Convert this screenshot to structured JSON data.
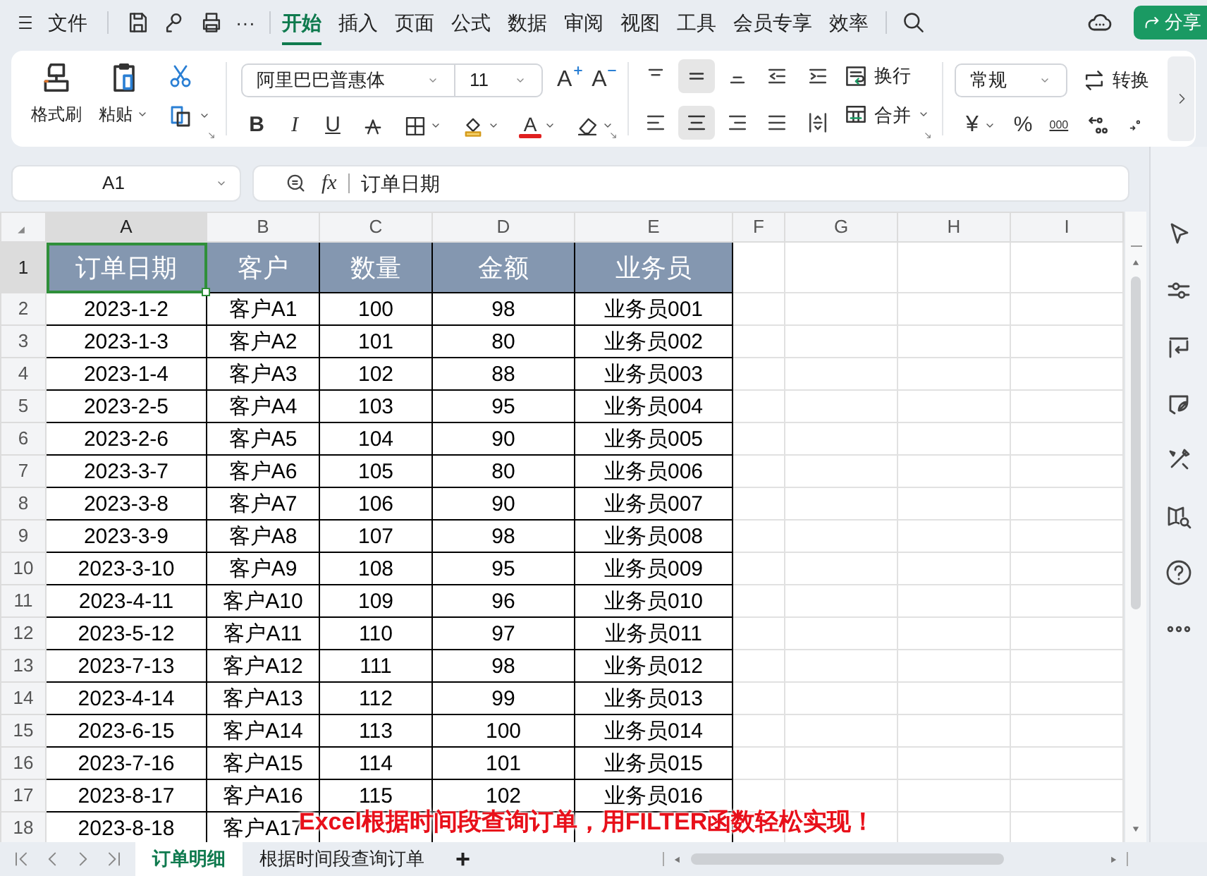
{
  "top_bar": {
    "file_menu": "文件",
    "more": "···",
    "tabs": [
      {
        "label": "开始",
        "selected": true
      },
      {
        "label": "插入",
        "selected": false
      },
      {
        "label": "页面",
        "selected": false
      },
      {
        "label": "公式",
        "selected": false
      },
      {
        "label": "数据",
        "selected": false
      },
      {
        "label": "审阅",
        "selected": false
      },
      {
        "label": "视图",
        "selected": false
      },
      {
        "label": "工具",
        "selected": false
      },
      {
        "label": "会员专享",
        "selected": false
      },
      {
        "label": "效率",
        "selected": false
      }
    ],
    "share_button": "分享"
  },
  "ribbon": {
    "format_painter": "格式刷",
    "paste": "粘贴",
    "font_name": "阿里巴巴普惠体",
    "font_size": "11",
    "grow_font": "A",
    "shrink_font": "A",
    "styles": [
      {
        "kind": "bold",
        "label": "B"
      },
      {
        "kind": "italic",
        "label": "I"
      },
      {
        "kind": "underline",
        "label": "U"
      }
    ],
    "font_color": "A",
    "align_buttons": [
      {
        "kind": "top",
        "selected": false
      },
      {
        "kind": "middle",
        "selected": true
      },
      {
        "kind": "bottom",
        "selected": false
      },
      {
        "kind": "outdent",
        "selected": false
      },
      {
        "kind": "indent",
        "selected": false
      },
      {
        "kind": "left",
        "selected": false
      },
      {
        "kind": "center",
        "selected": true
      },
      {
        "kind": "right",
        "selected": false
      },
      {
        "kind": "justify",
        "selected": false
      },
      {
        "kind": "distributed",
        "selected": false
      }
    ],
    "wrap": "换行",
    "merge": "合并",
    "number_format": "常规",
    "convert": "转换",
    "currency": "¥",
    "percent": "%",
    "thousands": "000"
  },
  "formula_bar": {
    "name_box": "A1",
    "fx": "fx",
    "value": "订单日期"
  },
  "sheet": {
    "columns": [
      {
        "label": "A",
        "selected": true
      },
      {
        "label": "B",
        "selected": false
      },
      {
        "label": "C",
        "selected": false
      },
      {
        "label": "D",
        "selected": false
      },
      {
        "label": "E",
        "selected": false
      },
      {
        "label": "F",
        "selected": false
      },
      {
        "label": "G",
        "selected": false
      },
      {
        "label": "H",
        "selected": false
      },
      {
        "label": "I",
        "selected": false
      }
    ],
    "rows": [
      {
        "number": "1",
        "selected": true,
        "kind": "header",
        "cells": [
          "订单日期",
          "客户",
          "数量",
          "金额",
          "业务员"
        ]
      },
      {
        "number": "2",
        "selected": false,
        "kind": "data",
        "cells": [
          "2023-1-2",
          "客户A1",
          "100",
          "98",
          "业务员001"
        ]
      },
      {
        "number": "3",
        "selected": false,
        "kind": "data",
        "cells": [
          "2023-1-3",
          "客户A2",
          "101",
          "80",
          "业务员002"
        ]
      },
      {
        "number": "4",
        "selected": false,
        "kind": "data",
        "cells": [
          "2023-1-4",
          "客户A3",
          "102",
          "88",
          "业务员003"
        ]
      },
      {
        "number": "5",
        "selected": false,
        "kind": "data",
        "cells": [
          "2023-2-5",
          "客户A4",
          "103",
          "95",
          "业务员004"
        ]
      },
      {
        "number": "6",
        "selected": false,
        "kind": "data",
        "cells": [
          "2023-2-6",
          "客户A5",
          "104",
          "90",
          "业务员005"
        ]
      },
      {
        "number": "7",
        "selected": false,
        "kind": "data",
        "cells": [
          "2023-3-7",
          "客户A6",
          "105",
          "80",
          "业务员006"
        ]
      },
      {
        "number": "8",
        "selected": false,
        "kind": "data",
        "cells": [
          "2023-3-8",
          "客户A7",
          "106",
          "90",
          "业务员007"
        ]
      },
      {
        "number": "9",
        "selected": false,
        "kind": "data",
        "cells": [
          "2023-3-9",
          "客户A8",
          "107",
          "98",
          "业务员008"
        ]
      },
      {
        "number": "10",
        "selected": false,
        "kind": "data",
        "cells": [
          "2023-3-10",
          "客户A9",
          "108",
          "95",
          "业务员009"
        ]
      },
      {
        "number": "11",
        "selected": false,
        "kind": "data",
        "cells": [
          "2023-4-11",
          "客户A10",
          "109",
          "96",
          "业务员010"
        ]
      },
      {
        "number": "12",
        "selected": false,
        "kind": "data",
        "cells": [
          "2023-5-12",
          "客户A11",
          "110",
          "97",
          "业务员011"
        ]
      },
      {
        "number": "13",
        "selected": false,
        "kind": "data",
        "cells": [
          "2023-7-13",
          "客户A12",
          "111",
          "98",
          "业务员012"
        ]
      },
      {
        "number": "14",
        "selected": false,
        "kind": "data",
        "cells": [
          "2023-4-14",
          "客户A13",
          "112",
          "99",
          "业务员013"
        ]
      },
      {
        "number": "15",
        "selected": false,
        "kind": "data",
        "cells": [
          "2023-6-15",
          "客户A14",
          "113",
          "100",
          "业务员014"
        ]
      },
      {
        "number": "16",
        "selected": false,
        "kind": "data",
        "cells": [
          "2023-7-16",
          "客户A15",
          "114",
          "101",
          "业务员015"
        ]
      },
      {
        "number": "17",
        "selected": false,
        "kind": "data",
        "cells": [
          "2023-8-17",
          "客户A16",
          "115",
          "102",
          "业务员016"
        ]
      },
      {
        "number": "18",
        "selected": false,
        "kind": "data",
        "cells": [
          "2023-8-18",
          "客户A17"
        ]
      }
    ]
  },
  "sheet_tabs": [
    {
      "label": "订单明细",
      "selected": true
    },
    {
      "label": "根据时间段查询订单",
      "selected": false
    }
  ],
  "add_sheet": "+",
  "caption": "Excel根据时间段查询订单，用FILTER函数轻松实现！"
}
